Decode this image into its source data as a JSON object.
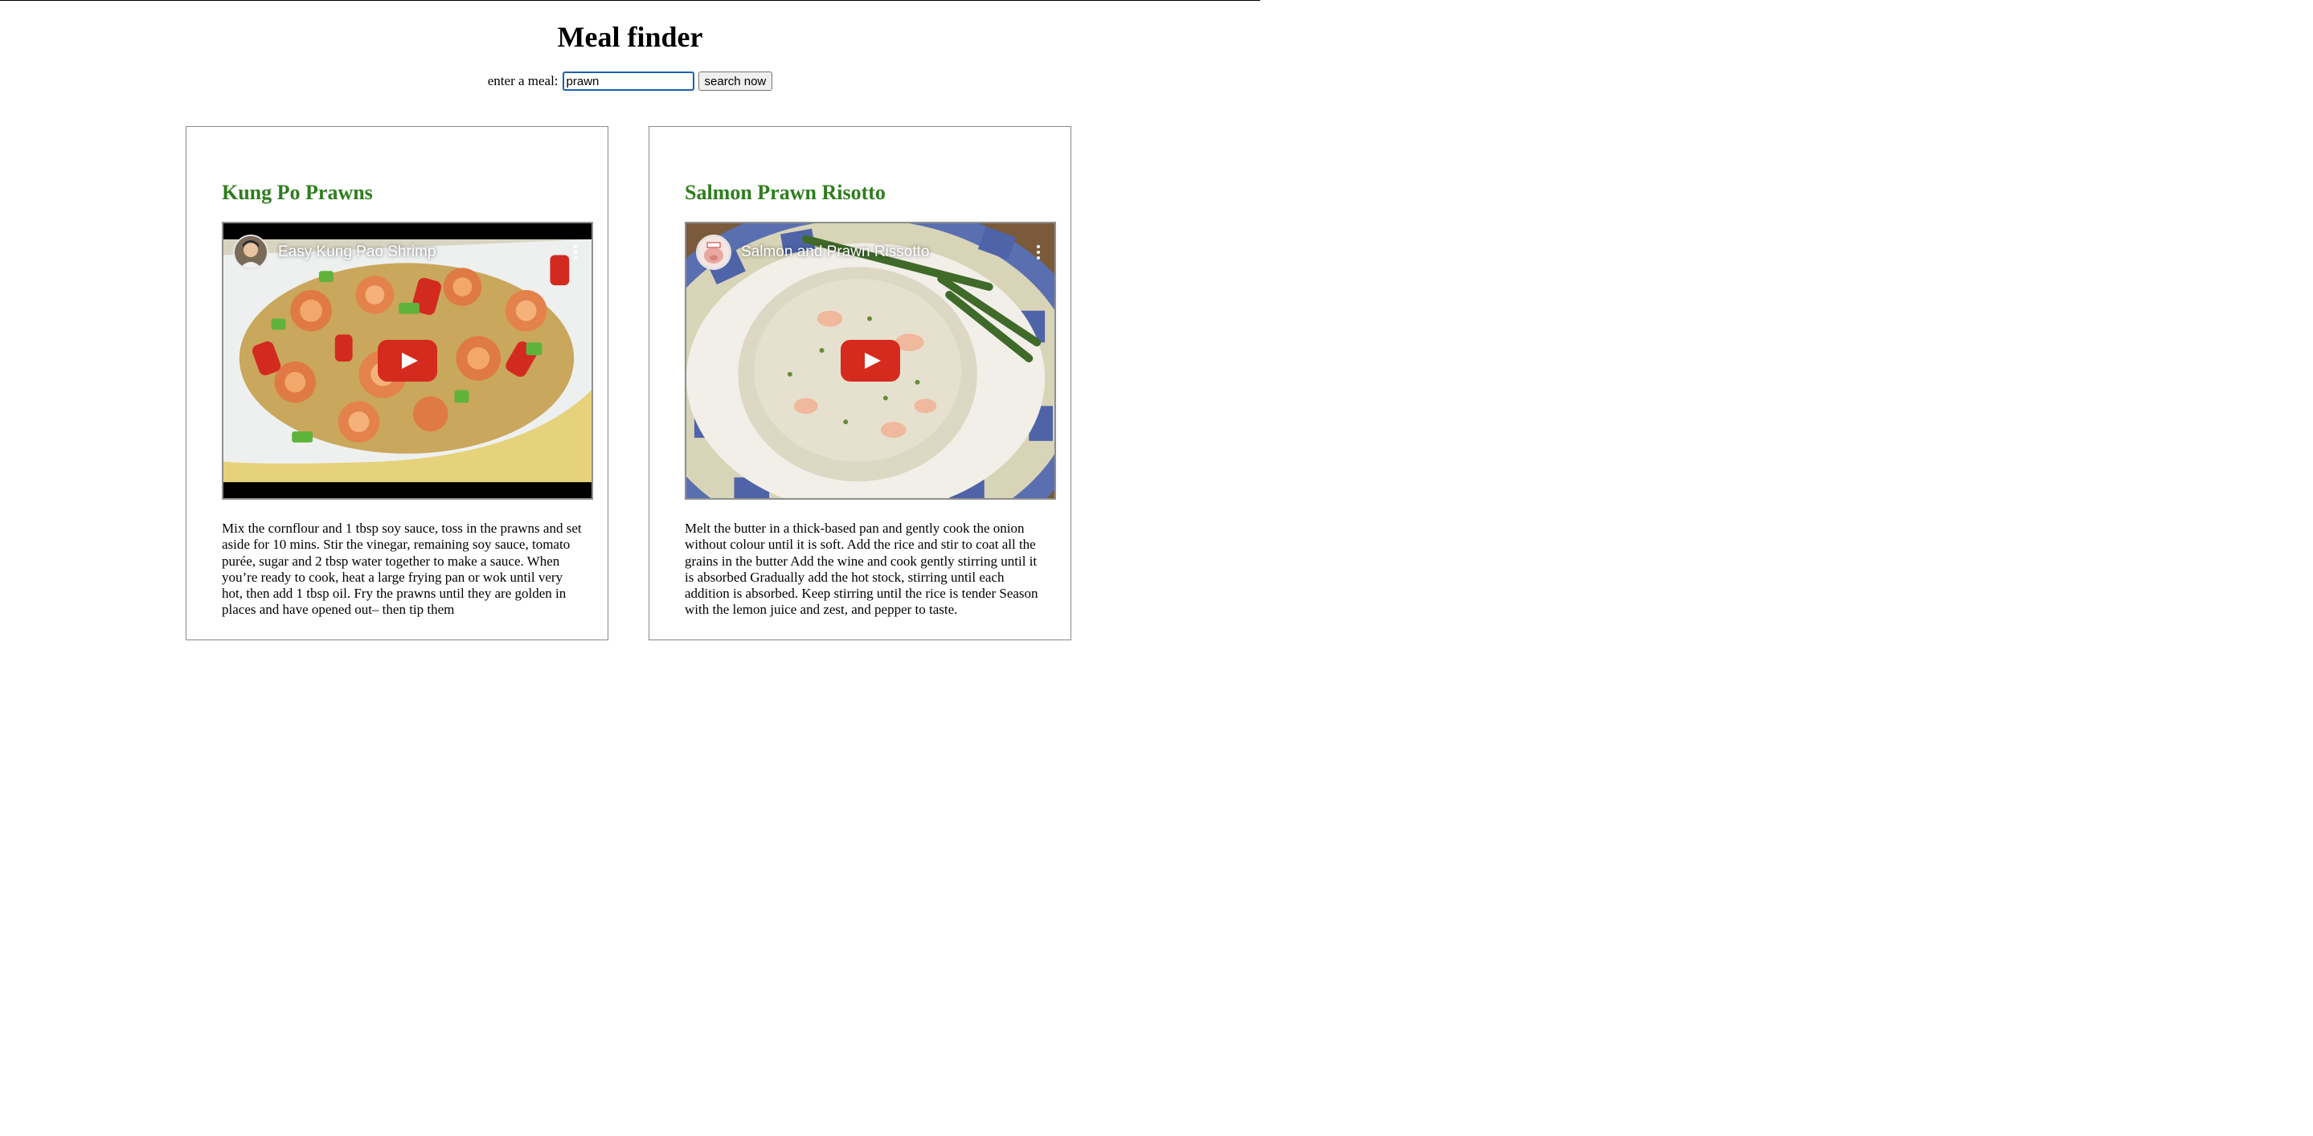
{
  "page": {
    "title": "Meal finder"
  },
  "search": {
    "label": "enter a meal:",
    "value": "prawn",
    "button_label": "search now"
  },
  "colors": {
    "meal_title": "#2f7d1e",
    "input_focus_border": "#1a5fb4",
    "play_button": "#d52b1e"
  },
  "meals": [
    {
      "name": "Kung Po Prawns",
      "video": {
        "title": "Easy Kung Pao Shrimp",
        "avatar_icon": "chef-avatar-icon",
        "play_icon": "youtube-play-icon",
        "menu_icon": "more-vertical-icon"
      },
      "instructions": "Mix the cornflour and 1 tbsp soy sauce, toss in the prawns and set aside for 10 mins. Stir the vinegar, remaining soy sauce, tomato purée, sugar and 2 tbsp water together to make a sauce. When you’re ready to cook, heat a large frying pan or wok until very hot, then add 1 tbsp oil. Fry the prawns until they are golden in places and have opened out– then tip them"
    },
    {
      "name": "Salmon Prawn Risotto",
      "video": {
        "title": "Salmon and Prawn Rissotto",
        "avatar_icon": "pig-avatar-icon",
        "play_icon": "youtube-play-icon",
        "menu_icon": "more-vertical-icon"
      },
      "instructions": "Melt the butter in a thick-based pan and gently cook the onion without colour until it is soft. Add the rice and stir to coat all the grains in the butter Add the wine and cook gently stirring until it is absorbed Gradually add the hot stock, stirring until each addition is absorbed. Keep stirring until the rice is tender Season with the lemon juice and zest, and pepper to taste."
    }
  ]
}
